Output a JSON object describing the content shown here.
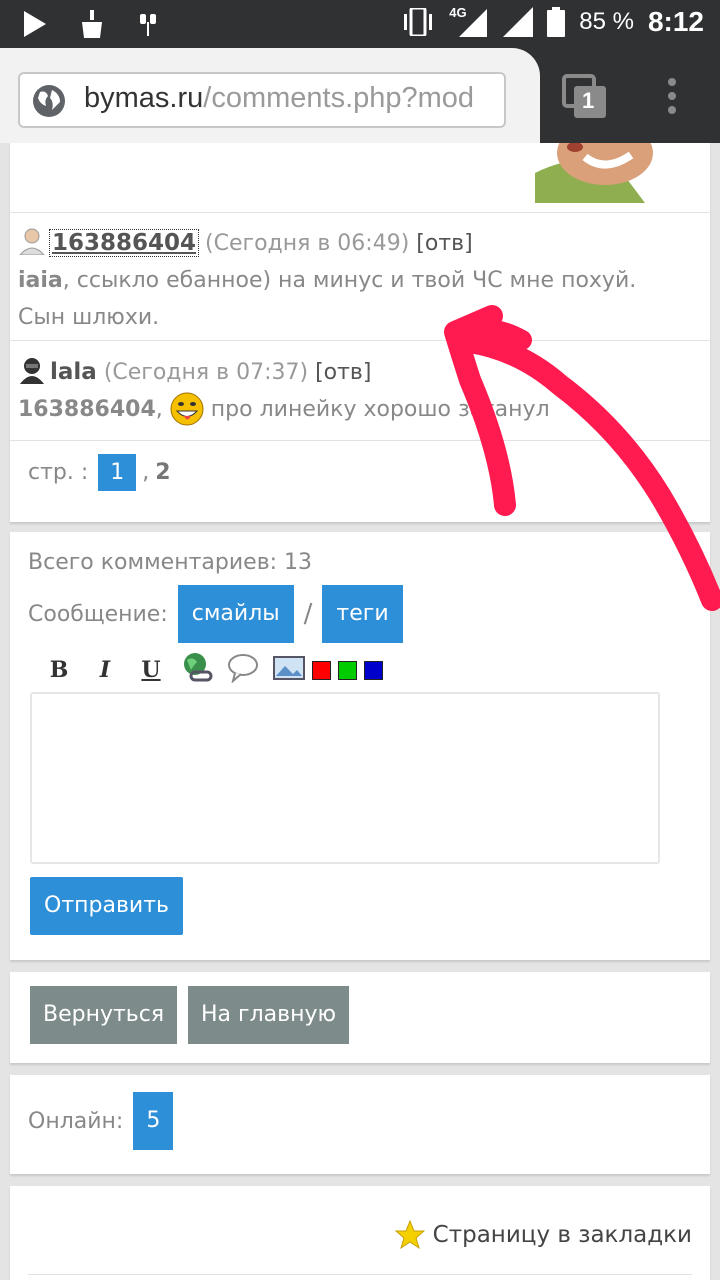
{
  "status_bar": {
    "network": "4G",
    "battery_percent": "85 %",
    "time": "8:12",
    "icons": [
      "play-icon",
      "broom-icon",
      "headphone-icon",
      "vibrate-icon",
      "signal-icon",
      "battery-icon"
    ]
  },
  "browser": {
    "url_host": "bymas.ru",
    "url_path": "/comments.php?mod",
    "tab_count": "1",
    "icons": [
      "globe-icon",
      "tabs-icon",
      "overflow-menu-icon"
    ]
  },
  "comments": [
    {
      "author": "163886404",
      "time": "(Сегодня в 06:49)",
      "reply": "[отв]",
      "mention": "iaia",
      "text_line1": ", ссыкло ебанное) на минус и твой ЧС мне похуй.",
      "text_line2": "Сын шлюхи."
    },
    {
      "author": "lala",
      "time": "(Сегодня в 07:37)",
      "reply": "[отв]",
      "mention": "163886404",
      "text": "про линейку хорошо заганул"
    }
  ],
  "pager": {
    "label": "стр. :",
    "current": "1",
    "separator": ",",
    "next": "2"
  },
  "form": {
    "total_label": "Всего комментариев: 13",
    "message_label": "Сообщение:",
    "smiles_button": "смайлы",
    "slash": "/",
    "tags_button": "теги",
    "toolbar": {
      "bold": "B",
      "italic": "I",
      "underline": "U"
    },
    "colors": [
      "#ff0000",
      "#00cc00",
      "#0000cc"
    ],
    "submit": "Отправить"
  },
  "nav": {
    "back": "Вернуться",
    "home": "На главную"
  },
  "online": {
    "label": "Онлайн:",
    "count": "5"
  },
  "bookmark": {
    "label": "Страницу в закладки"
  },
  "colors": {
    "accent": "#2d8fd8",
    "annotation": "#ff1a4f",
    "gray_button": "#7e8b8b"
  }
}
